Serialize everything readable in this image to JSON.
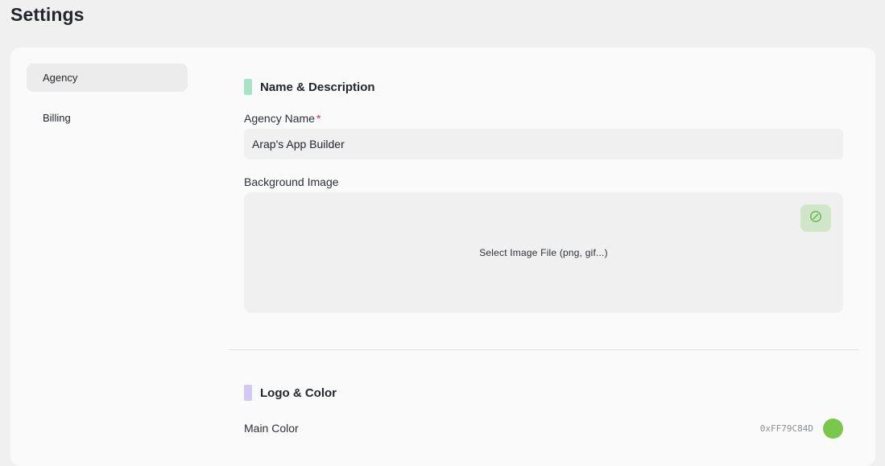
{
  "header": {
    "title": "Settings"
  },
  "sidebar": {
    "items": [
      {
        "label": "Agency",
        "active": true
      },
      {
        "label": "Billing",
        "active": false
      }
    ]
  },
  "sections": {
    "name_description": {
      "title": "Name & Description",
      "accent_color": "#a7e3c4",
      "agency_name": {
        "label": "Agency Name",
        "required_mark": "*",
        "value": "Arap's App Builder"
      },
      "background_image": {
        "label": "Background Image",
        "dropzone_text": "Select Image File (png, gif...)",
        "clear_icon": "block-icon"
      }
    },
    "logo_color": {
      "title": "Logo & Color",
      "accent_color": "#d4c6f5",
      "main_color": {
        "label": "Main Color",
        "hex": "0xFF79C84D",
        "swatch": "#79c84d"
      }
    }
  }
}
